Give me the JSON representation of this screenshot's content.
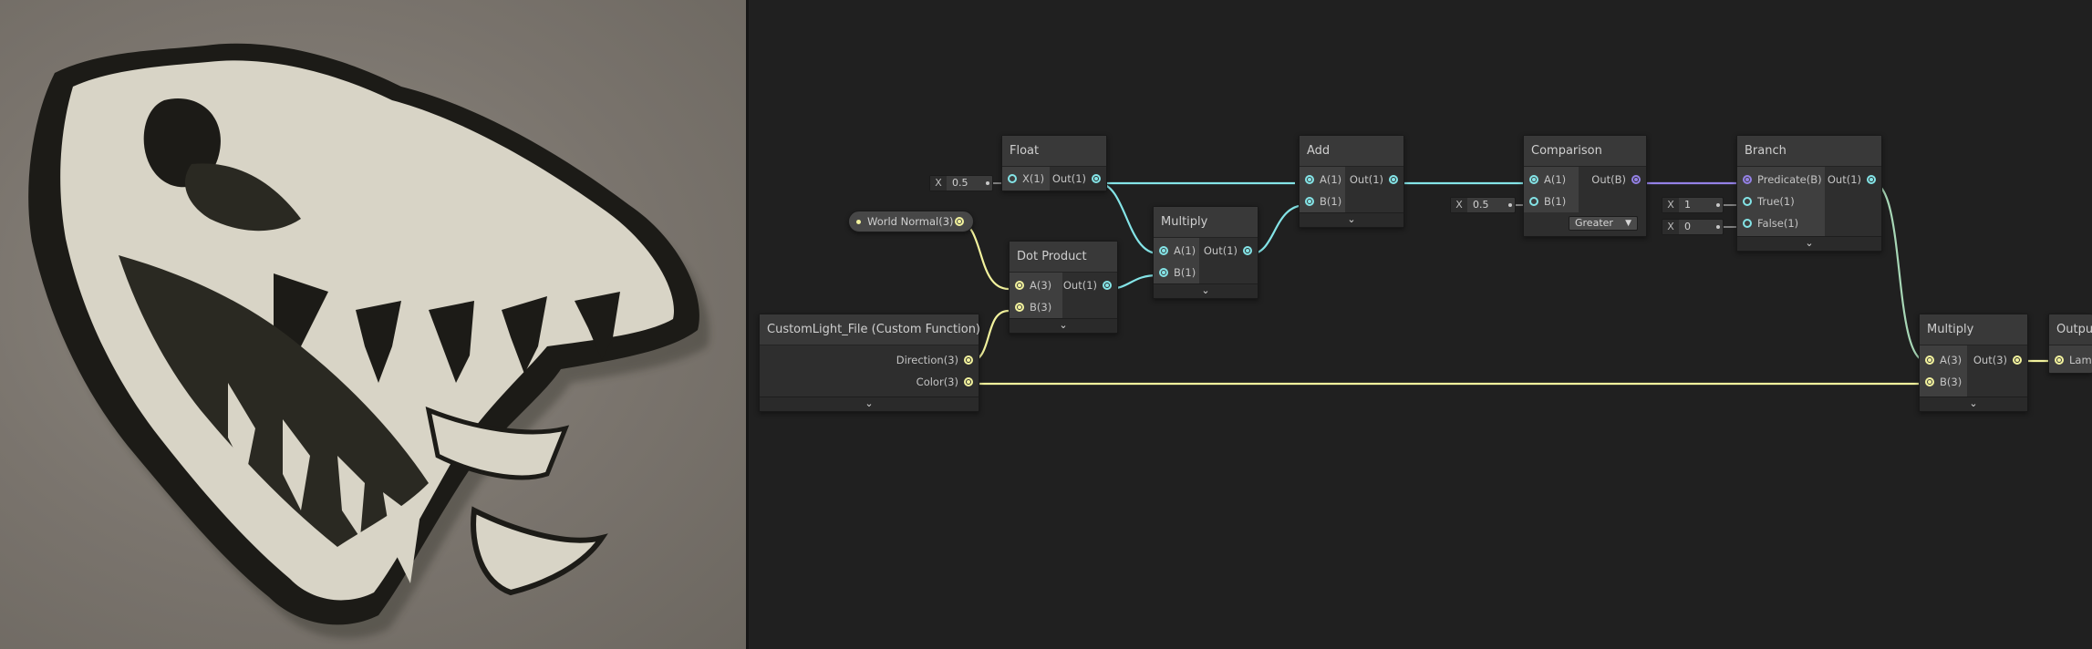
{
  "nodes": {
    "float": {
      "title": "Float",
      "in": "X(1)",
      "out": "Out(1)",
      "input_x_label": "X",
      "input_x_value": "0.5"
    },
    "multiply_1": {
      "title": "Multiply",
      "in_a": "A(1)",
      "in_b": "B(1)",
      "out": "Out(1)"
    },
    "dot_product": {
      "title": "Dot Product",
      "in_a": "A(3)",
      "in_b": "B(3)",
      "out": "Out(1)"
    },
    "add": {
      "title": "Add",
      "in_a": "A(1)",
      "in_b": "B(1)",
      "out": "Out(1)"
    },
    "comparison": {
      "title": "Comparison",
      "in_a": "A(1)",
      "in_b": "B(1)",
      "out": "Out(B)",
      "input_b_label": "X",
      "input_b_value": "0.5",
      "mode": "Greater"
    },
    "branch": {
      "title": "Branch",
      "in_pred": "Predicate(B)",
      "in_true": "True(1)",
      "in_false": "False(1)",
      "out": "Out(1)",
      "true_label": "X",
      "true_value": "1",
      "false_label": "X",
      "false_value": "0"
    },
    "custom_function": {
      "title": "CustomLight_File (Custom Function)",
      "out_direction": "Direction(3)",
      "out_color": "Color(3)"
    },
    "multiply_2": {
      "title": "Multiply",
      "in_a": "A(3)",
      "in_b": "B(3)",
      "out": "Out(3)"
    },
    "output": {
      "title": "Output",
      "in": "Lamb"
    },
    "world_normal": {
      "label": "World Normal(3)"
    }
  },
  "icons": {
    "collapse": "chevron-down-icon"
  },
  "colors": {
    "vector1": "#84e4e7",
    "vector3": "#f2f29d",
    "boolean": "#9481e6",
    "background": "#202020",
    "node": "#393939"
  }
}
